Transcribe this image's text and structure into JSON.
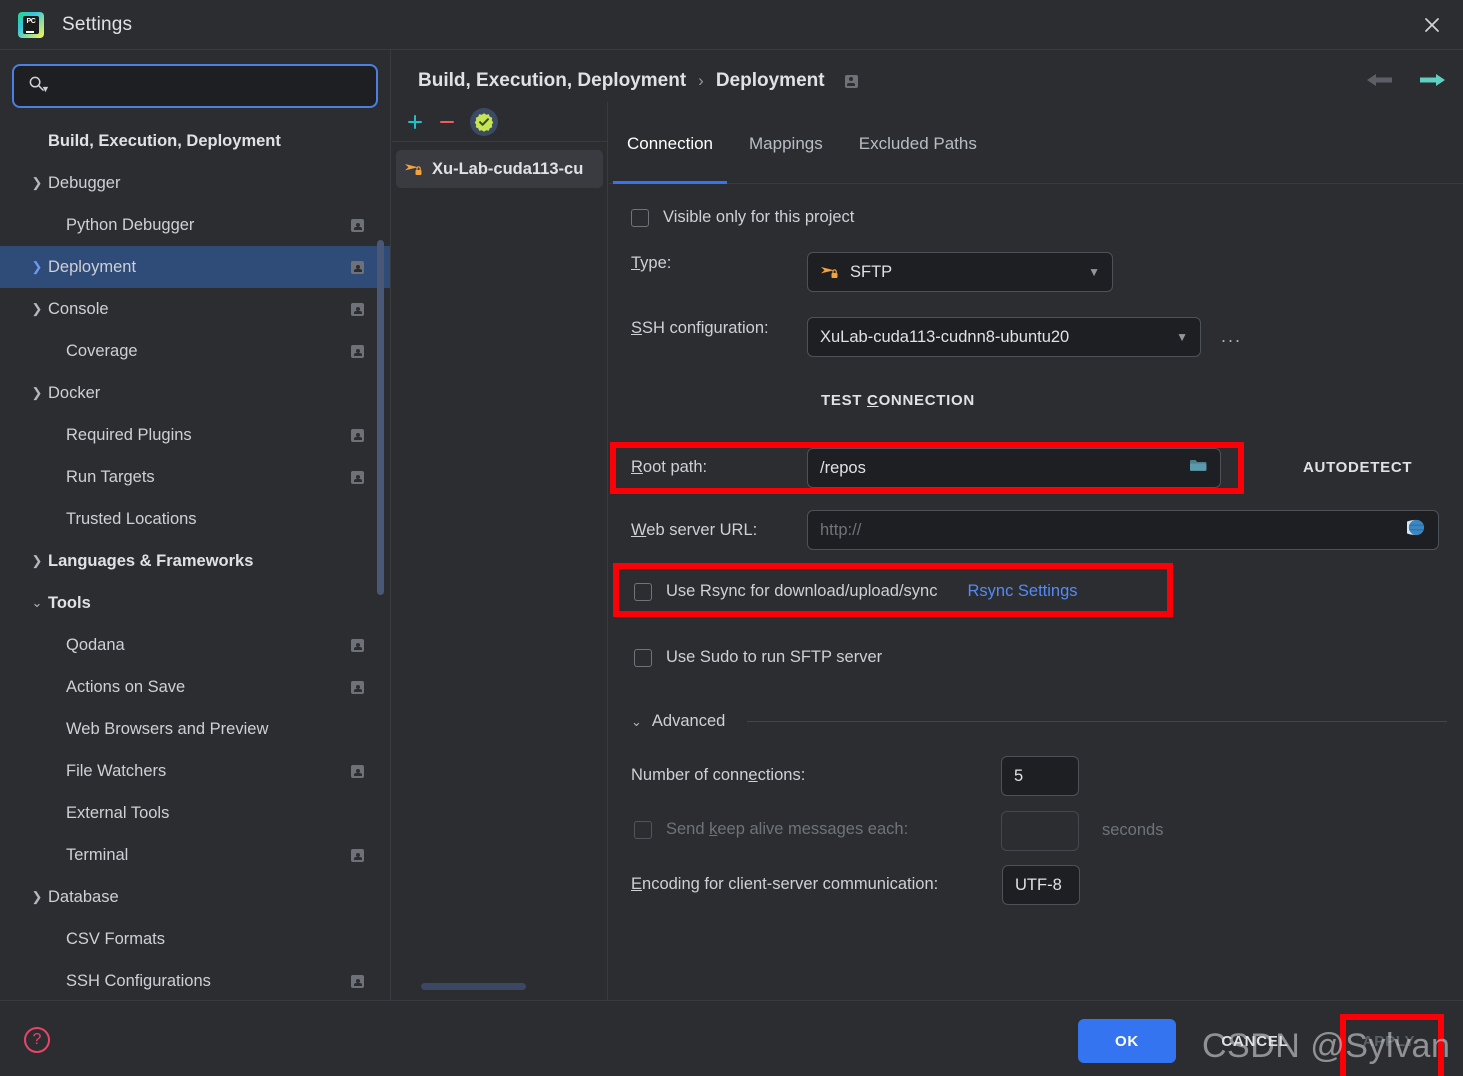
{
  "window": {
    "title": "Settings",
    "logo_icon": "pycharm-logo",
    "close_icon": "close-icon"
  },
  "search": {
    "placeholder": "",
    "value": "",
    "icon": "search-icon"
  },
  "sidebar": {
    "items": [
      {
        "label": "Build, Execution, Deployment",
        "indent": 0,
        "arrow": "none",
        "bold": true,
        "badge": false,
        "selected": false
      },
      {
        "label": "Debugger",
        "indent": 1,
        "arrow": "right",
        "bold": false,
        "badge": false,
        "selected": false
      },
      {
        "label": "Python Debugger",
        "indent": 2,
        "arrow": "none",
        "bold": false,
        "badge": true,
        "selected": false
      },
      {
        "label": "Deployment",
        "indent": 1,
        "arrow": "right",
        "bold": false,
        "badge": true,
        "selected": true
      },
      {
        "label": "Console",
        "indent": 1,
        "arrow": "right",
        "bold": false,
        "badge": true,
        "selected": false
      },
      {
        "label": "Coverage",
        "indent": 2,
        "arrow": "none",
        "bold": false,
        "badge": true,
        "selected": false
      },
      {
        "label": "Docker",
        "indent": 1,
        "arrow": "right",
        "bold": false,
        "badge": false,
        "selected": false
      },
      {
        "label": "Required Plugins",
        "indent": 2,
        "arrow": "none",
        "bold": false,
        "badge": true,
        "selected": false
      },
      {
        "label": "Run Targets",
        "indent": 2,
        "arrow": "none",
        "bold": false,
        "badge": true,
        "selected": false
      },
      {
        "label": "Trusted Locations",
        "indent": 2,
        "arrow": "none",
        "bold": false,
        "badge": false,
        "selected": false
      },
      {
        "label": "Languages & Frameworks",
        "indent": 0,
        "arrow": "right",
        "bold": true,
        "badge": false,
        "selected": false
      },
      {
        "label": "Tools",
        "indent": 0,
        "arrow": "down",
        "bold": true,
        "badge": false,
        "selected": false
      },
      {
        "label": "Qodana",
        "indent": 2,
        "arrow": "none",
        "bold": false,
        "badge": true,
        "selected": false
      },
      {
        "label": "Actions on Save",
        "indent": 2,
        "arrow": "none",
        "bold": false,
        "badge": true,
        "selected": false
      },
      {
        "label": "Web Browsers and Preview",
        "indent": 2,
        "arrow": "none",
        "bold": false,
        "badge": false,
        "selected": false
      },
      {
        "label": "File Watchers",
        "indent": 2,
        "arrow": "none",
        "bold": false,
        "badge": true,
        "selected": false
      },
      {
        "label": "External Tools",
        "indent": 2,
        "arrow": "none",
        "bold": false,
        "badge": false,
        "selected": false
      },
      {
        "label": "Terminal",
        "indent": 2,
        "arrow": "none",
        "bold": false,
        "badge": true,
        "selected": false
      },
      {
        "label": "Database",
        "indent": 1,
        "arrow": "right",
        "bold": false,
        "badge": false,
        "selected": false
      },
      {
        "label": "CSV Formats",
        "indent": 2,
        "arrow": "none",
        "bold": false,
        "badge": false,
        "selected": false
      },
      {
        "label": "SSH Configurations",
        "indent": 2,
        "arrow": "none",
        "bold": false,
        "badge": true,
        "selected": false
      }
    ]
  },
  "breadcrumb": {
    "parent": "Build, Execution, Deployment",
    "separator": "›",
    "current": "Deployment",
    "back_icon": "arrow-left-icon",
    "forward_icon": "arrow-right-icon"
  },
  "server_panel": {
    "add_label": "+",
    "remove_label": "−",
    "default_badge_icon": "verified-check-icon",
    "servers": [
      {
        "name": "Xu-Lab-cuda113-cu",
        "icon": "sftp-icon"
      }
    ]
  },
  "tabs": [
    {
      "label": "Connection",
      "active": true
    },
    {
      "label": "Mappings",
      "active": false
    },
    {
      "label": "Excluded Paths",
      "active": false
    }
  ],
  "connection": {
    "visible_only_label": "Visible only for this project",
    "visible_only_checked": false,
    "type_label": "Type:",
    "type_label_mnemonic": "T",
    "type_value": "SFTP",
    "type_icon": "sftp-icon",
    "ssh_config_label": "SSH configuration:",
    "ssh_config_label_mnemonic": "S",
    "ssh_config_value": "XuLab-cuda113-cudnn8-ubuntu20",
    "ssh_config_more_label": "...",
    "test_connection_label": "TEST CONNECTION",
    "test_connection_mnemonic": "C",
    "root_path_label": "Root path:",
    "root_path_label_mnemonic": "R",
    "root_path_value": "/repos",
    "root_path_browse_icon": "folder-icon",
    "root_path_help_icon": "help-circle-icon",
    "autodetect_label": "AUTODETECT",
    "web_server_url_label": "Web server URL:",
    "web_server_url_label_mnemonic": "W",
    "web_server_url_value": "http://",
    "web_server_url_icon": "globe-icon",
    "use_rsync_label": "Use Rsync for download/upload/sync",
    "use_rsync_checked": false,
    "rsync_settings_link": "Rsync Settings",
    "use_sudo_label": "Use Sudo to run SFTP server",
    "use_sudo_checked": false
  },
  "advanced": {
    "header_label": "Advanced",
    "expanded": true,
    "connections_label": "Number of connections:",
    "connections_label_mnemonic": "e",
    "connections_value": "5",
    "keepalive_label": "Send keep alive messages each:",
    "keepalive_label_mnemonic": "k",
    "keepalive_checked": false,
    "keepalive_enabled": false,
    "keepalive_value": "",
    "seconds_label": "seconds",
    "encoding_label": "Encoding for client-server communication:",
    "encoding_label_mnemonic": "E",
    "encoding_value": "UTF-8"
  },
  "footer": {
    "help_icon": "help-circle-icon",
    "ok_label": "OK",
    "cancel_label": "CANCEL",
    "apply_label": "APPLY",
    "apply_enabled": false
  },
  "watermark": {
    "text": "CSDN @Sylvan Ding"
  },
  "annotations": {
    "color": "#fb0007",
    "boxes": [
      "root-path-row",
      "use-rsync-row",
      "apply-button"
    ]
  },
  "colors": {
    "accent_blue": "#3574f0",
    "dialog_bg": "#2b2d30",
    "field_bg": "#1e1f22",
    "selection_blue": "#2f4b78",
    "link_blue": "#548af7",
    "sftp_orange": "#f2a33c",
    "help_red": "#e8456a",
    "annotation_red": "#fb0007",
    "add_teal": "#20bfc9",
    "remove_red": "#ef5c5c",
    "forward_teal": "#5fd0c2"
  }
}
